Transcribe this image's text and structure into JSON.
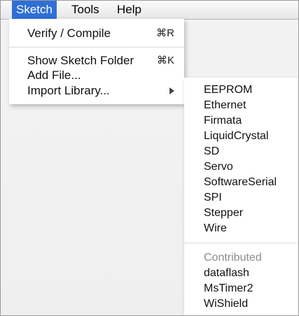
{
  "menubar": {
    "items": [
      "Sketch",
      "Tools",
      "Help"
    ]
  },
  "sketch_menu": {
    "verify": {
      "label": "Verify / Compile",
      "shortcut": "⌘R"
    },
    "show_folder": {
      "label": "Show Sketch Folder",
      "shortcut": "⌘K"
    },
    "add_file": {
      "label": "Add File..."
    },
    "import_library": {
      "label": "Import Library..."
    }
  },
  "library_submenu": {
    "core": [
      "EEPROM",
      "Ethernet",
      "Firmata",
      "LiquidCrystal",
      "SD",
      "Servo",
      "SoftwareSerial",
      "SPI",
      "Stepper",
      "Wire"
    ],
    "contributed_header": "Contributed",
    "contributed": [
      "dataflash",
      "MsTimer2",
      "WiShield"
    ]
  }
}
